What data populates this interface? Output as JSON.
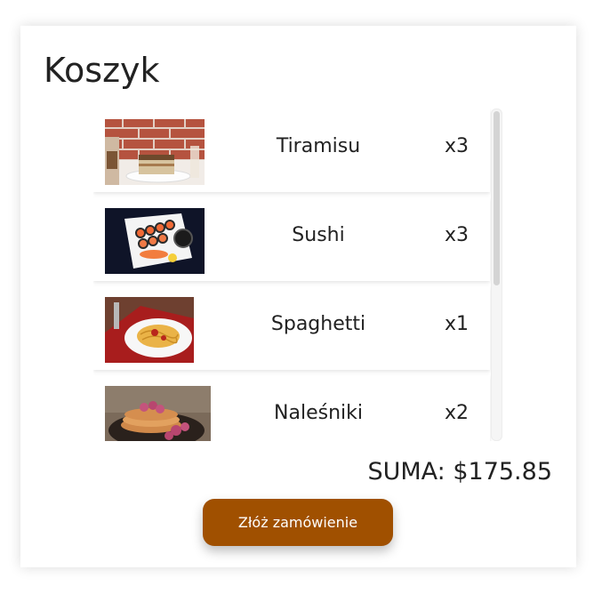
{
  "cart": {
    "title": "Koszyk",
    "items": [
      {
        "name": "Tiramisu",
        "qty": "x3",
        "image": "tiramisu-photo"
      },
      {
        "name": "Sushi",
        "qty": "x3",
        "image": "sushi-photo"
      },
      {
        "name": "Spaghetti",
        "qty": "x1",
        "image": "spaghetti-photo"
      },
      {
        "name": "Naleśniki",
        "qty": "x2",
        "image": "pancakes-photo"
      }
    ],
    "total": "SUMA: $175.85",
    "order_button": "Złóż zamówienie"
  },
  "colors": {
    "accent": "#a05000",
    "text": "#222222",
    "background": "#ffffff"
  }
}
